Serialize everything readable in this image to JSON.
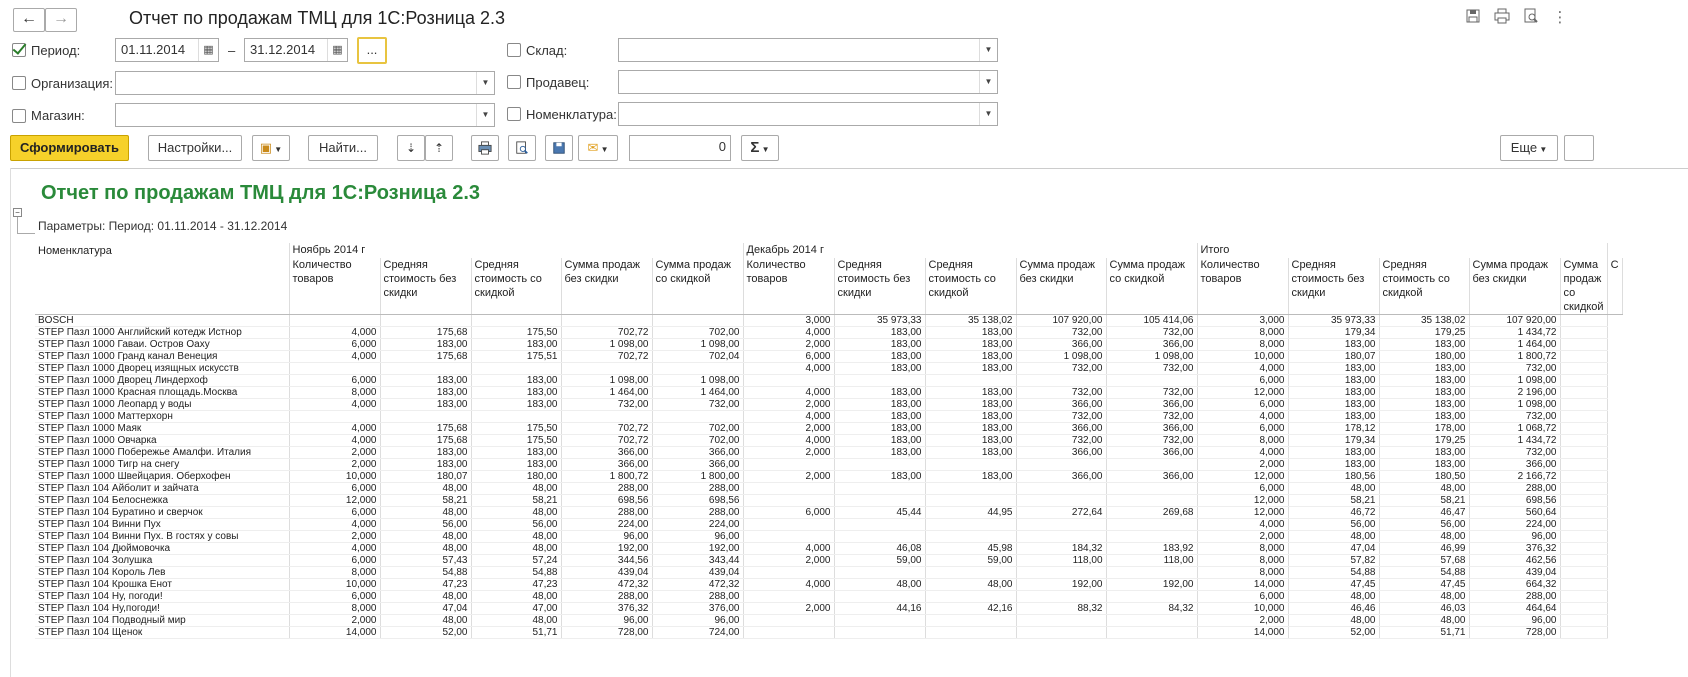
{
  "window": {
    "title": "Отчет по продажам ТМЦ  для 1С:Розница 2.3"
  },
  "icons": {
    "back": "←",
    "forward": "→",
    "save": "save-icon",
    "print": "print-icon",
    "preview": "preview-icon",
    "more": "⋮"
  },
  "filters": {
    "period_label": "Период:",
    "period_from": "01.11.2014",
    "period_to": "31.12.2014",
    "period_dash": "–",
    "period_more": "...",
    "org_label": "Организация:",
    "shop_label": "Магазин:",
    "warehouse_label": "Склад:",
    "seller_label": "Продавец:",
    "nomenclature_label": "Номенклатура:"
  },
  "toolbar": {
    "generate": "Сформировать",
    "settings": "Настройки...",
    "find": "Найти...",
    "sum_value": "0",
    "more": "Еще"
  },
  "report": {
    "title": "Отчет по продажам ТМЦ для 1С:Розница 2.3",
    "params": "Параметры:   Период: 01.11.2014 - 31.12.2014",
    "col_name": "Номенклатура",
    "groups": [
      "Ноябрь 2014 г",
      "Декабрь 2014 г",
      "Итого"
    ],
    "subcols": [
      "Количество товаров",
      "Средняя стоимость без скидки",
      "Средняя стоимость со скидкой",
      "Сумма продаж без скидки",
      "Сумма продаж со скидкой"
    ],
    "last_col_partial": "С",
    "rows": [
      [
        "BOSCH",
        "",
        "",
        "",
        "",
        "",
        "3,000",
        "35 973,33",
        "35 138,02",
        "107 920,00",
        "105 414,06",
        "3,000",
        "35 973,33",
        "35 138,02",
        "107 920,00"
      ],
      [
        "STEP Пазл 1000 Английский котедж Истнор",
        "4,000",
        "175,68",
        "175,50",
        "702,72",
        "702,00",
        "4,000",
        "183,00",
        "183,00",
        "732,00",
        "732,00",
        "8,000",
        "179,34",
        "179,25",
        "1 434,72"
      ],
      [
        "STEP Пазл 1000 Гаваи. Остров Оаху",
        "6,000",
        "183,00",
        "183,00",
        "1 098,00",
        "1 098,00",
        "2,000",
        "183,00",
        "183,00",
        "366,00",
        "366,00",
        "8,000",
        "183,00",
        "183,00",
        "1 464,00"
      ],
      [
        "STEP Пазл 1000 Гранд канал Венеция",
        "4,000",
        "175,68",
        "175,51",
        "702,72",
        "702,04",
        "6,000",
        "183,00",
        "183,00",
        "1 098,00",
        "1 098,00",
        "10,000",
        "180,07",
        "180,00",
        "1 800,72"
      ],
      [
        "STEP Пазл 1000 Дворец изящных искусств",
        "",
        "",
        "",
        "",
        "",
        "4,000",
        "183,00",
        "183,00",
        "732,00",
        "732,00",
        "4,000",
        "183,00",
        "183,00",
        "732,00"
      ],
      [
        "STEP Пазл 1000 Дворец Линдерхоф",
        "6,000",
        "183,00",
        "183,00",
        "1 098,00",
        "1 098,00",
        "",
        "",
        "",
        "",
        "",
        "6,000",
        "183,00",
        "183,00",
        "1 098,00"
      ],
      [
        "STEP Пазл 1000 Красная площадь.Москва",
        "8,000",
        "183,00",
        "183,00",
        "1 464,00",
        "1 464,00",
        "4,000",
        "183,00",
        "183,00",
        "732,00",
        "732,00",
        "12,000",
        "183,00",
        "183,00",
        "2 196,00"
      ],
      [
        "STEP Пазл 1000 Леопард у воды",
        "4,000",
        "183,00",
        "183,00",
        "732,00",
        "732,00",
        "2,000",
        "183,00",
        "183,00",
        "366,00",
        "366,00",
        "6,000",
        "183,00",
        "183,00",
        "1 098,00"
      ],
      [
        "STEP Пазл 1000 Маттерхорн",
        "",
        "",
        "",
        "",
        "",
        "4,000",
        "183,00",
        "183,00",
        "732,00",
        "732,00",
        "4,000",
        "183,00",
        "183,00",
        "732,00"
      ],
      [
        "STEP Пазл 1000 Маяк",
        "4,000",
        "175,68",
        "175,50",
        "702,72",
        "702,00",
        "2,000",
        "183,00",
        "183,00",
        "366,00",
        "366,00",
        "6,000",
        "178,12",
        "178,00",
        "1 068,72"
      ],
      [
        "STEP Пазл 1000 Овчарка",
        "4,000",
        "175,68",
        "175,50",
        "702,72",
        "702,00",
        "4,000",
        "183,00",
        "183,00",
        "732,00",
        "732,00",
        "8,000",
        "179,34",
        "179,25",
        "1 434,72"
      ],
      [
        "STEP Пазл 1000 Побережье Амалфи. Италия",
        "2,000",
        "183,00",
        "183,00",
        "366,00",
        "366,00",
        "2,000",
        "183,00",
        "183,00",
        "366,00",
        "366,00",
        "4,000",
        "183,00",
        "183,00",
        "732,00"
      ],
      [
        "STEP Пазл 1000 Тигр на снегу",
        "2,000",
        "183,00",
        "183,00",
        "366,00",
        "366,00",
        "",
        "",
        "",
        "",
        "",
        "2,000",
        "183,00",
        "183,00",
        "366,00"
      ],
      [
        "STEP Пазл 1000 Швейцария. Оберхофен",
        "10,000",
        "180,07",
        "180,00",
        "1 800,72",
        "1 800,00",
        "2,000",
        "183,00",
        "183,00",
        "366,00",
        "366,00",
        "12,000",
        "180,56",
        "180,50",
        "2 166,72"
      ],
      [
        "STEP Пазл 104 Айболит и зайчата",
        "6,000",
        "48,00",
        "48,00",
        "288,00",
        "288,00",
        "",
        "",
        "",
        "",
        "",
        "6,000",
        "48,00",
        "48,00",
        "288,00"
      ],
      [
        "STEP Пазл 104 Белоснежка",
        "12,000",
        "58,21",
        "58,21",
        "698,56",
        "698,56",
        "",
        "",
        "",
        "",
        "",
        "12,000",
        "58,21",
        "58,21",
        "698,56"
      ],
      [
        "STEP Пазл 104 Буратино и сверчок",
        "6,000",
        "48,00",
        "48,00",
        "288,00",
        "288,00",
        "6,000",
        "45,44",
        "44,95",
        "272,64",
        "269,68",
        "12,000",
        "46,72",
        "46,47",
        "560,64"
      ],
      [
        "STEP Пазл 104 Винни Пух",
        "4,000",
        "56,00",
        "56,00",
        "224,00",
        "224,00",
        "",
        "",
        "",
        "",
        "",
        "4,000",
        "56,00",
        "56,00",
        "224,00"
      ],
      [
        "STEP Пазл 104 Винни Пух. В гостях у совы",
        "2,000",
        "48,00",
        "48,00",
        "96,00",
        "96,00",
        "",
        "",
        "",
        "",
        "",
        "2,000",
        "48,00",
        "48,00",
        "96,00"
      ],
      [
        "STEP Пазл 104 Дюймовочка",
        "4,000",
        "48,00",
        "48,00",
        "192,00",
        "192,00",
        "4,000",
        "46,08",
        "45,98",
        "184,32",
        "183,92",
        "8,000",
        "47,04",
        "46,99",
        "376,32"
      ],
      [
        "STEP Пазл 104 Золушка",
        "6,000",
        "57,43",
        "57,24",
        "344,56",
        "343,44",
        "2,000",
        "59,00",
        "59,00",
        "118,00",
        "118,00",
        "8,000",
        "57,82",
        "57,68",
        "462,56"
      ],
      [
        "STEP Пазл 104 Король Лев",
        "8,000",
        "54,88",
        "54,88",
        "439,04",
        "439,04",
        "",
        "",
        "",
        "",
        "",
        "8,000",
        "54,88",
        "54,88",
        "439,04"
      ],
      [
        "STEP Пазл 104 Крошка Енот",
        "10,000",
        "47,23",
        "47,23",
        "472,32",
        "472,32",
        "4,000",
        "48,00",
        "48,00",
        "192,00",
        "192,00",
        "14,000",
        "47,45",
        "47,45",
        "664,32"
      ],
      [
        "STEP Пазл 104 Ну, погоди!",
        "6,000",
        "48,00",
        "48,00",
        "288,00",
        "288,00",
        "",
        "",
        "",
        "",
        "",
        "6,000",
        "48,00",
        "48,00",
        "288,00"
      ],
      [
        "STEP Пазл 104 Ну,погоди!",
        "8,000",
        "47,04",
        "47,00",
        "376,32",
        "376,00",
        "2,000",
        "44,16",
        "42,16",
        "88,32",
        "84,32",
        "10,000",
        "46,46",
        "46,03",
        "464,64"
      ],
      [
        "STEP Пазл 104 Подводный мир",
        "2,000",
        "48,00",
        "48,00",
        "96,00",
        "96,00",
        "",
        "",
        "",
        "",
        "",
        "2,000",
        "48,00",
        "48,00",
        "96,00"
      ],
      [
        "STEP Пазл 104 Щенок",
        "14,000",
        "52,00",
        "51,71",
        "728,00",
        "724,00",
        "",
        "",
        "",
        "",
        "",
        "14,000",
        "52,00",
        "51,71",
        "728,00"
      ]
    ]
  }
}
